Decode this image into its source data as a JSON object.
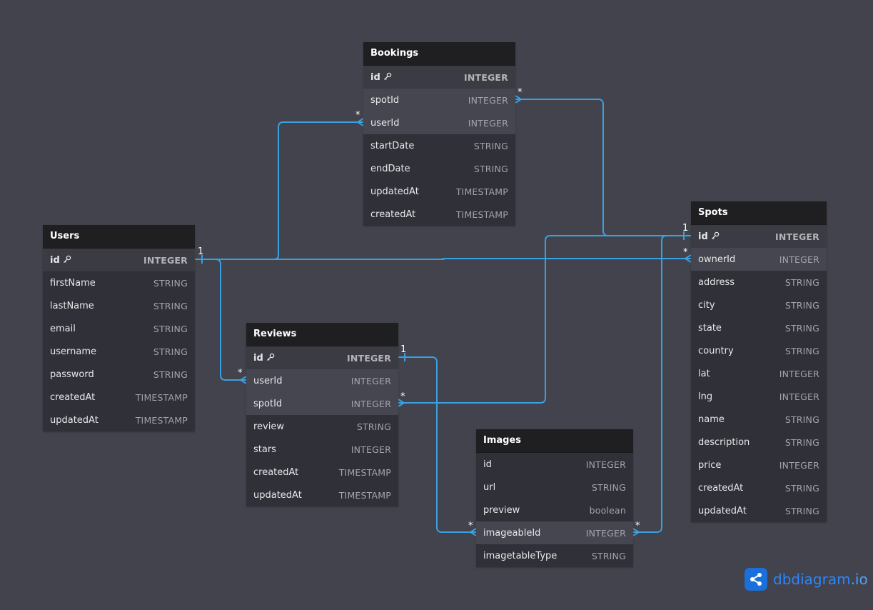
{
  "tables": [
    {
      "key": "bookings",
      "name": "Bookings",
      "fields": [
        {
          "name": "id",
          "type": "INTEGER",
          "pk": true
        },
        {
          "name": "spotId",
          "type": "INTEGER",
          "hl": true
        },
        {
          "name": "userId",
          "type": "INTEGER",
          "hl": true
        },
        {
          "name": "startDate",
          "type": "STRING"
        },
        {
          "name": "endDate",
          "type": "STRING"
        },
        {
          "name": "updatedAt",
          "type": "TIMESTAMP"
        },
        {
          "name": "createdAt",
          "type": "TIMESTAMP"
        }
      ]
    },
    {
      "key": "users",
      "name": "Users",
      "fields": [
        {
          "name": "id",
          "type": "INTEGER",
          "pk": true
        },
        {
          "name": "firstName",
          "type": "STRING"
        },
        {
          "name": "lastName",
          "type": "STRING"
        },
        {
          "name": "email",
          "type": "STRING"
        },
        {
          "name": "username",
          "type": "STRING"
        },
        {
          "name": "password",
          "type": "STRING"
        },
        {
          "name": "createdAt",
          "type": "TIMESTAMP"
        },
        {
          "name": "updatedAt",
          "type": "TIMESTAMP"
        }
      ]
    },
    {
      "key": "reviews",
      "name": "Reviews",
      "fields": [
        {
          "name": "id",
          "type": "INTEGER",
          "pk": true
        },
        {
          "name": "userId",
          "type": "INTEGER",
          "hl": true
        },
        {
          "name": "spotId",
          "type": "INTEGER",
          "hl": true
        },
        {
          "name": "review",
          "type": "STRING"
        },
        {
          "name": "stars",
          "type": "INTEGER"
        },
        {
          "name": "createdAt",
          "type": "TIMESTAMP"
        },
        {
          "name": "updatedAt",
          "type": "TIMESTAMP"
        }
      ]
    },
    {
      "key": "images",
      "name": "Images",
      "fields": [
        {
          "name": "id",
          "type": "INTEGER"
        },
        {
          "name": "url",
          "type": "STRING"
        },
        {
          "name": "preview",
          "type": "boolean"
        },
        {
          "name": "imageableId",
          "type": "INTEGER",
          "hl": true
        },
        {
          "name": "imagetableType",
          "type": "STRING"
        }
      ]
    },
    {
      "key": "spots",
      "name": "Spots",
      "fields": [
        {
          "name": "id",
          "type": "INTEGER",
          "pk": true
        },
        {
          "name": "ownerId",
          "type": "INTEGER",
          "hl": true
        },
        {
          "name": "address",
          "type": "STRING"
        },
        {
          "name": "city",
          "type": "STRING"
        },
        {
          "name": "state",
          "type": "STRING"
        },
        {
          "name": "country",
          "type": "STRING"
        },
        {
          "name": "lat",
          "type": "INTEGER"
        },
        {
          "name": "lng",
          "type": "INTEGER"
        },
        {
          "name": "name",
          "type": "STRING"
        },
        {
          "name": "description",
          "type": "STRING"
        },
        {
          "name": "price",
          "type": "INTEGER"
        },
        {
          "name": "createdAt",
          "type": "STRING"
        },
        {
          "name": "updatedAt",
          "type": "STRING"
        }
      ]
    }
  ],
  "relationships": [
    {
      "from": "users.id",
      "to": "bookings.userId",
      "from_card": "1",
      "to_card": "*"
    },
    {
      "from": "users.id",
      "to": "reviews.userId",
      "from_card": "1",
      "to_card": "*"
    },
    {
      "from": "users.id",
      "to": "spots.ownerId",
      "from_card": "1",
      "to_card": "*"
    },
    {
      "from": "spots.id",
      "to": "bookings.spotId",
      "from_card": "1",
      "to_card": "*"
    },
    {
      "from": "spots.id",
      "to": "reviews.spotId",
      "from_card": "1",
      "to_card": "*"
    },
    {
      "from": "spots.id",
      "to": "images.imageableId",
      "from_card": "1",
      "to_card": "*"
    },
    {
      "from": "reviews.id",
      "to": "images.imageableId",
      "from_card": "1",
      "to_card": "*"
    }
  ],
  "brand": {
    "name": "dbdiagram",
    "tld": ".io"
  },
  "colors": {
    "background": "#42434c",
    "link": "#3aa0e0",
    "header": "#1f1f22",
    "brand": "#2a86ff"
  }
}
